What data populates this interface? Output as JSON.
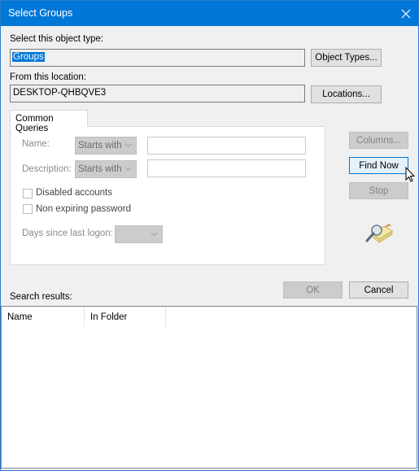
{
  "window": {
    "title": "Select Groups",
    "close_icon": "close-icon"
  },
  "object_type": {
    "label": "Select this object type:",
    "value": "Groups",
    "button": "Object Types..."
  },
  "location": {
    "label": "From this location:",
    "value": "DESKTOP-QHBQVE3",
    "button": "Locations..."
  },
  "tabs": [
    {
      "label": "Common Queries"
    }
  ],
  "queries": {
    "name_label": "Name:",
    "name_mode": "Starts with",
    "name_value": "",
    "description_label": "Description:",
    "description_mode": "Starts with",
    "description_value": "",
    "disabled_accounts": {
      "label": "Disabled accounts",
      "checked": false
    },
    "non_expiring_password": {
      "label": "Non expiring password",
      "checked": false
    },
    "days_label": "Days since last logon:",
    "days_value": ""
  },
  "side_buttons": {
    "columns": "Columns...",
    "find_now": "Find Now",
    "stop": "Stop",
    "icon": "search-directory-icon"
  },
  "footer": {
    "ok": "OK",
    "cancel": "Cancel"
  },
  "results": {
    "label": "Search results:",
    "columns": [
      "Name",
      "In Folder"
    ],
    "rows": []
  }
}
